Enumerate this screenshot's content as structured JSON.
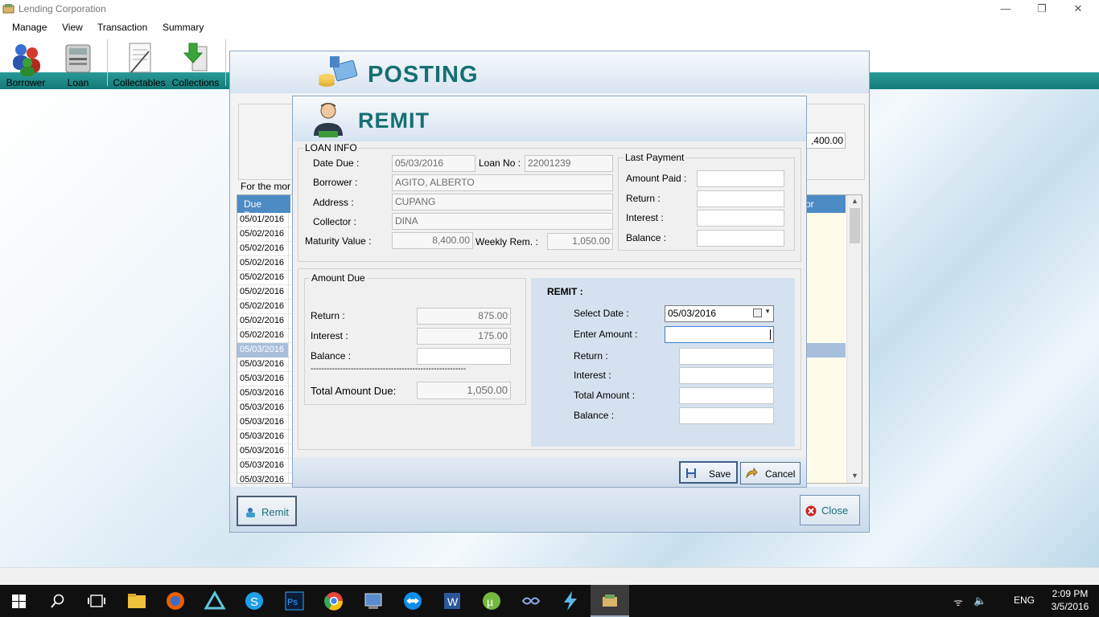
{
  "window": {
    "title": "Lending Corporation",
    "minimize": "—",
    "restore": "❐",
    "close": "✕"
  },
  "menu": [
    "Manage",
    "View",
    "Transaction",
    "Summary"
  ],
  "toolbar": {
    "items": [
      {
        "label": "Borrower",
        "icon": "borrower-icon"
      },
      {
        "label": "Loan",
        "icon": "loan-icon"
      },
      {
        "label": "Collectables",
        "icon": "collectables-icon"
      },
      {
        "label": "Collections",
        "icon": "collections-icon"
      }
    ]
  },
  "posting": {
    "title": "POSTING",
    "amount_partial": ",400.00",
    "for_month_partial": "For the mor",
    "grid": {
      "col_due_date": "Due Date",
      "col_collector_partial": "or",
      "rows": [
        "05/01/2016",
        "05/02/2016",
        "05/02/2016",
        "05/02/2016",
        "05/02/2016",
        "05/02/2016",
        "05/02/2016",
        "05/02/2016",
        "05/02/2016",
        "05/03/2016",
        "05/03/2016",
        "05/03/2016",
        "05/03/2016",
        "05/03/2016",
        "05/03/2016",
        "05/03/2016",
        "05/03/2016",
        "05/03/2016",
        "05/03/2016"
      ],
      "selected_index": 9
    },
    "remit_button": "Remit",
    "close_button": "Close"
  },
  "remit": {
    "title": "REMIT",
    "loan_info": {
      "legend": "LOAN INFO",
      "date_due_label": "Date Due :",
      "date_due": "05/03/2016",
      "loan_no_label": "Loan No :",
      "loan_no": "22001239",
      "borrower_label": "Borrower :",
      "borrower": "AGITO, ALBERTO",
      "address_label": "Address :",
      "address": "CUPANG",
      "collector_label": "Collector :",
      "collector": "DINA",
      "maturity_label": "Maturity Value :",
      "maturity": "8,400.00",
      "weekly_label": "Weekly Rem. :",
      "weekly": "1,050.00"
    },
    "last_payment": {
      "legend": "Last Payment",
      "amount_paid_label": "Amount Paid :",
      "return_label": "Return :",
      "interest_label": "Interest :",
      "balance_label": "Balance :"
    },
    "amount_due": {
      "legend": "Amount Due",
      "return_label": "Return :",
      "return": "875.00",
      "interest_label": "Interest :",
      "interest": "175.00",
      "balance_label": "Balance :",
      "dashes": "----------------------------------------------------------",
      "total_label": "Total Amount Due:",
      "total": "1,050.00"
    },
    "remit_panel": {
      "heading": "REMIT :",
      "select_date_label": "Select Date :",
      "select_date": "05/03/2016",
      "enter_amount_label": "Enter Amount :",
      "return_label": "Return :",
      "interest_label": "Interest :",
      "total_label": "Total Amount :",
      "balance_label": "Balance :"
    },
    "save_button": "Save",
    "cancel_button": "Cancel"
  },
  "taskbar": {
    "time": "2:09 PM",
    "date": "3/5/2016",
    "lang": "ENG"
  },
  "colors": {
    "accent": "#166f73",
    "grid_header": "#4d8bc4",
    "selection": "#a8bfdc",
    "toolbar_teal": "#1e8c8c"
  }
}
